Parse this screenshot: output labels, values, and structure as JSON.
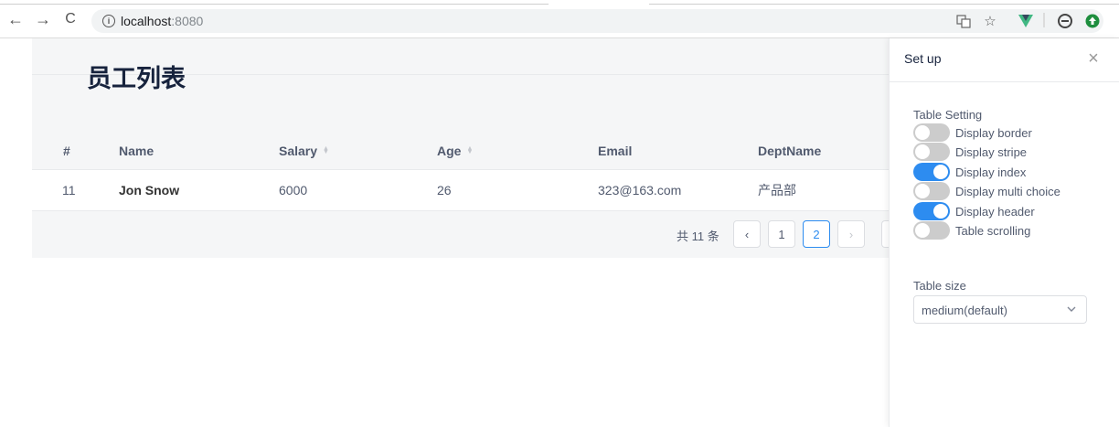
{
  "browser": {
    "url_host": "localhost",
    "url_port": ":8080"
  },
  "page": {
    "title": "员工列表"
  },
  "table": {
    "columns": [
      "#",
      "Name",
      "Salary",
      "Age",
      "Email",
      "DeptName"
    ],
    "rows": [
      {
        "index": "11",
        "name": "Jon Snow",
        "salary": "6000",
        "age": "26",
        "email": "323@163.com",
        "dept": "产品部"
      }
    ]
  },
  "pagination": {
    "total_text": "共 11 条",
    "prev": "‹",
    "pages": [
      "1",
      "2"
    ],
    "current": "2",
    "next": "›"
  },
  "drawer": {
    "title": "Set up",
    "close": "×",
    "table_setting_label": "Table Setting",
    "switches": [
      {
        "label": "Display border",
        "on": false
      },
      {
        "label": "Display stripe",
        "on": false
      },
      {
        "label": "Display index",
        "on": true
      },
      {
        "label": "Display multi choice",
        "on": false
      },
      {
        "label": "Display header",
        "on": true
      },
      {
        "label": "Table scrolling",
        "on": false
      }
    ],
    "table_size_label": "Table size",
    "table_size_value": "medium(default)"
  },
  "colors": {
    "accent": "#2d8cf0",
    "switch_off": "#cccccc"
  }
}
